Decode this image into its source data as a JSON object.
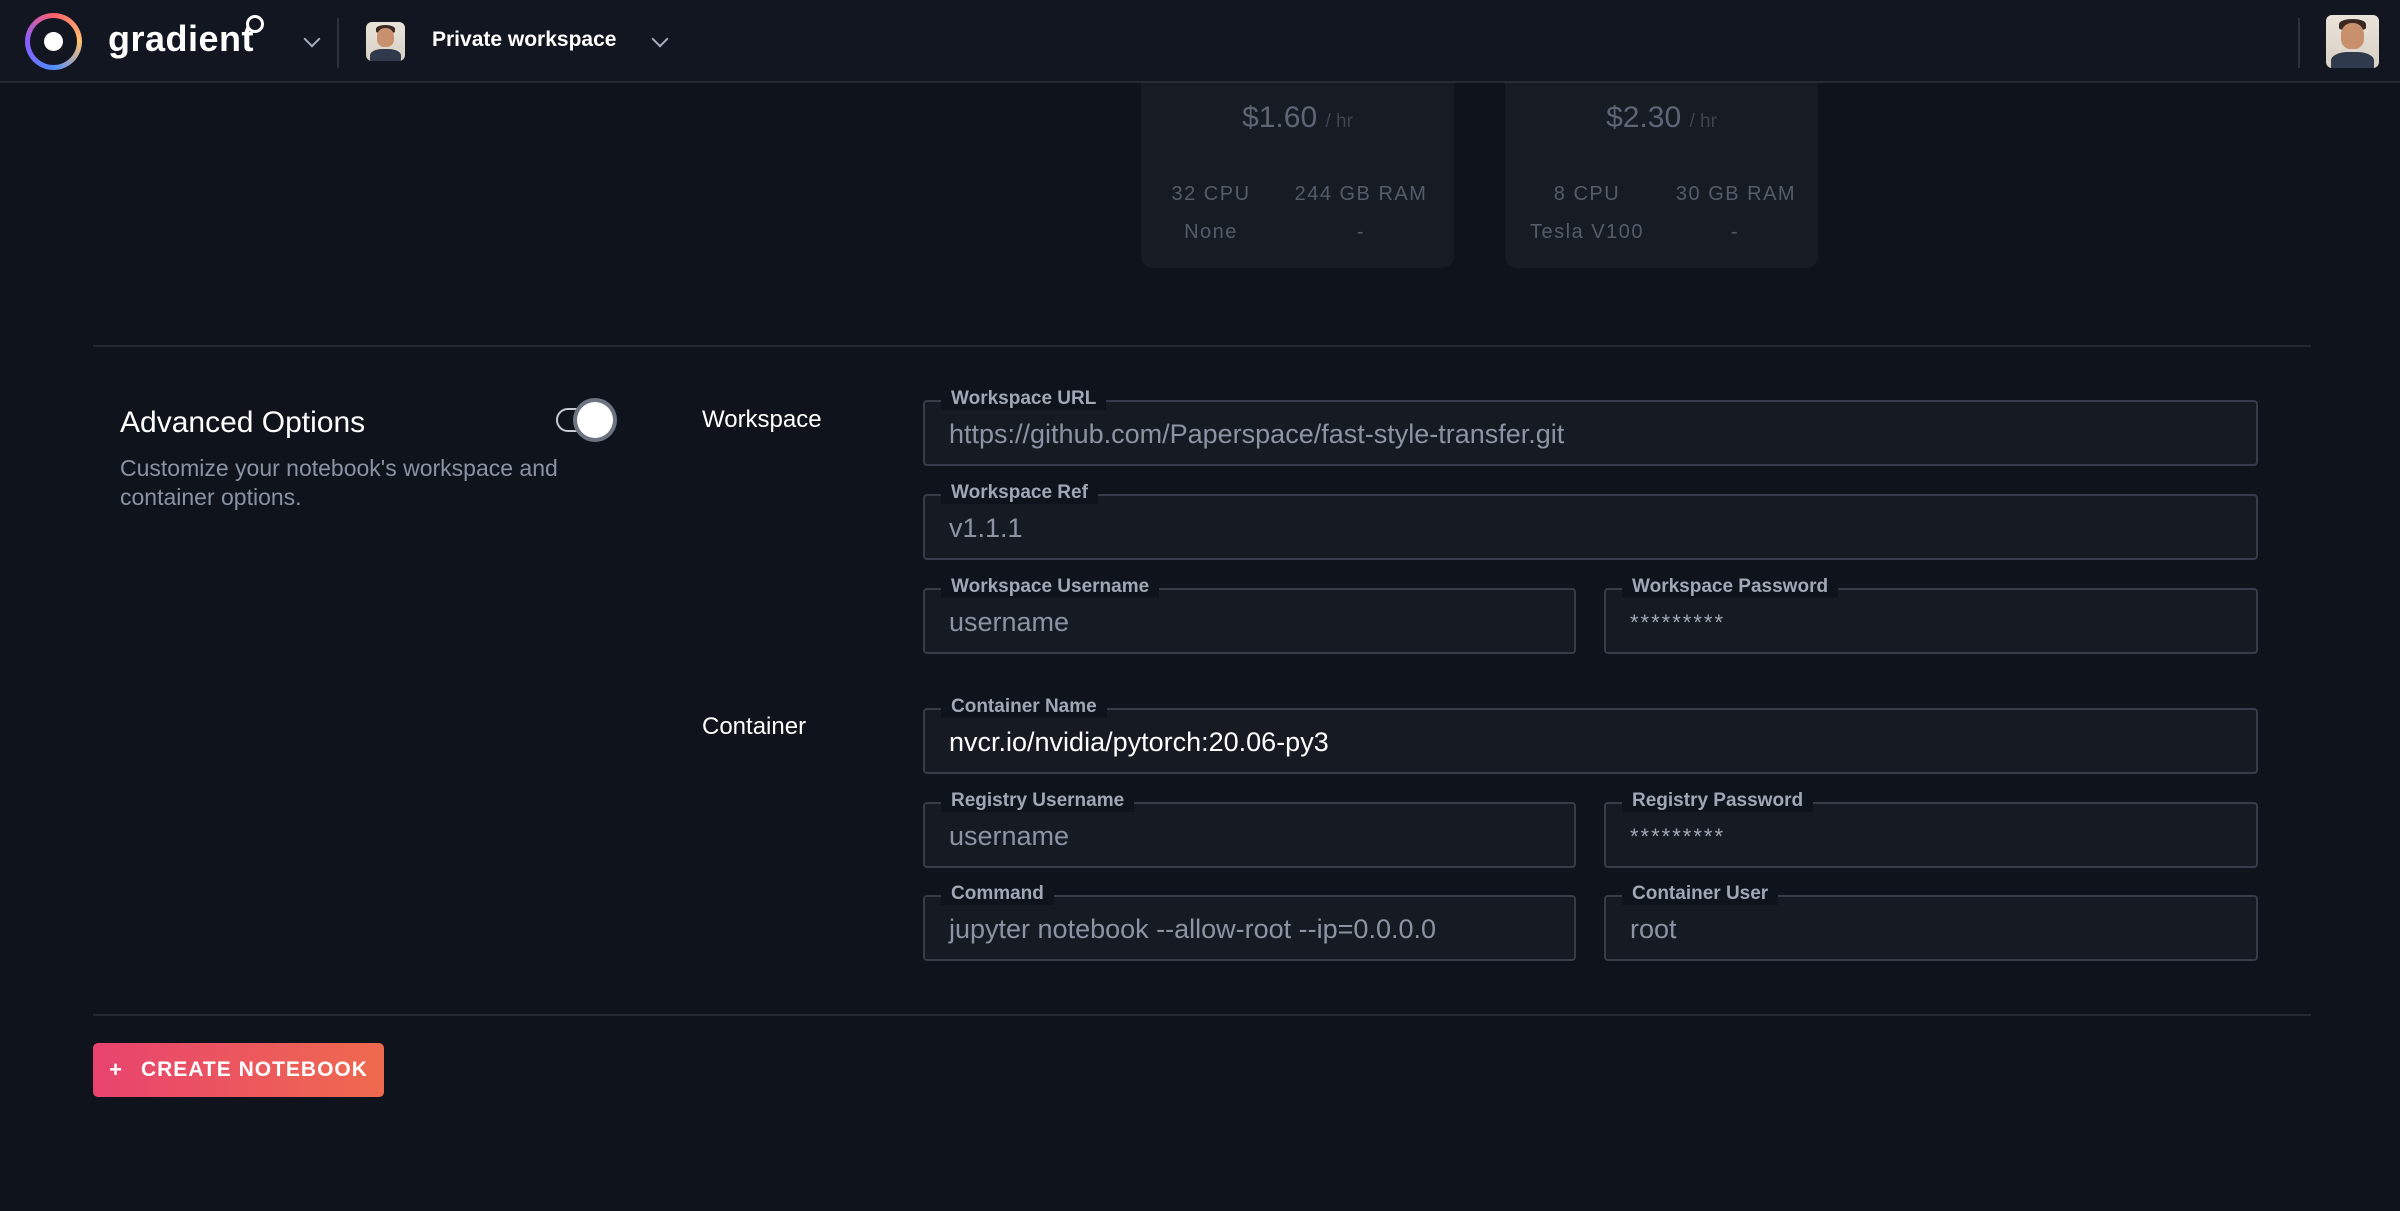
{
  "header": {
    "brand": "gradient",
    "workspace_name": "Private workspace"
  },
  "machines": [
    {
      "price": "$1.60",
      "unit": "/ hr",
      "cpu": "32 CPU",
      "ram": "244 GB RAM",
      "gpu": "None",
      "gpu_mem": "-"
    },
    {
      "price": "$2.30",
      "unit": "/ hr",
      "cpu": "8 CPU",
      "ram": "30 GB RAM",
      "gpu": "Tesla V100",
      "gpu_mem": "-"
    }
  ],
  "advanced": {
    "title": "Advanced Options",
    "description": "Customize your notebook's workspace and container options.",
    "enabled": true
  },
  "workspace": {
    "section_label": "Workspace",
    "url_label": "Workspace URL",
    "url_value": "https://github.com/Paperspace/fast-style-transfer.git",
    "ref_label": "Workspace Ref",
    "ref_value": "v1.1.1",
    "username_label": "Workspace Username",
    "username_value": "username",
    "password_label": "Workspace Password",
    "password_value": "*********"
  },
  "container": {
    "section_label": "Container",
    "name_label": "Container Name",
    "name_value": "nvcr.io/nvidia/pytorch:20.06-py3",
    "registry_username_label": "Registry Username",
    "registry_username_value": "username",
    "registry_password_label": "Registry Password",
    "registry_password_value": "*********",
    "command_label": "Command",
    "command_value": "jupyter notebook --allow-root --ip=0.0.0.0",
    "user_label": "Container User",
    "user_value": "root"
  },
  "actions": {
    "create_icon": "+",
    "create_label": "CREATE NOTEBOOK"
  },
  "colors": {
    "background": "#0f131b",
    "accent_start": "#e8436f",
    "accent_end": "#ef6a4e"
  }
}
